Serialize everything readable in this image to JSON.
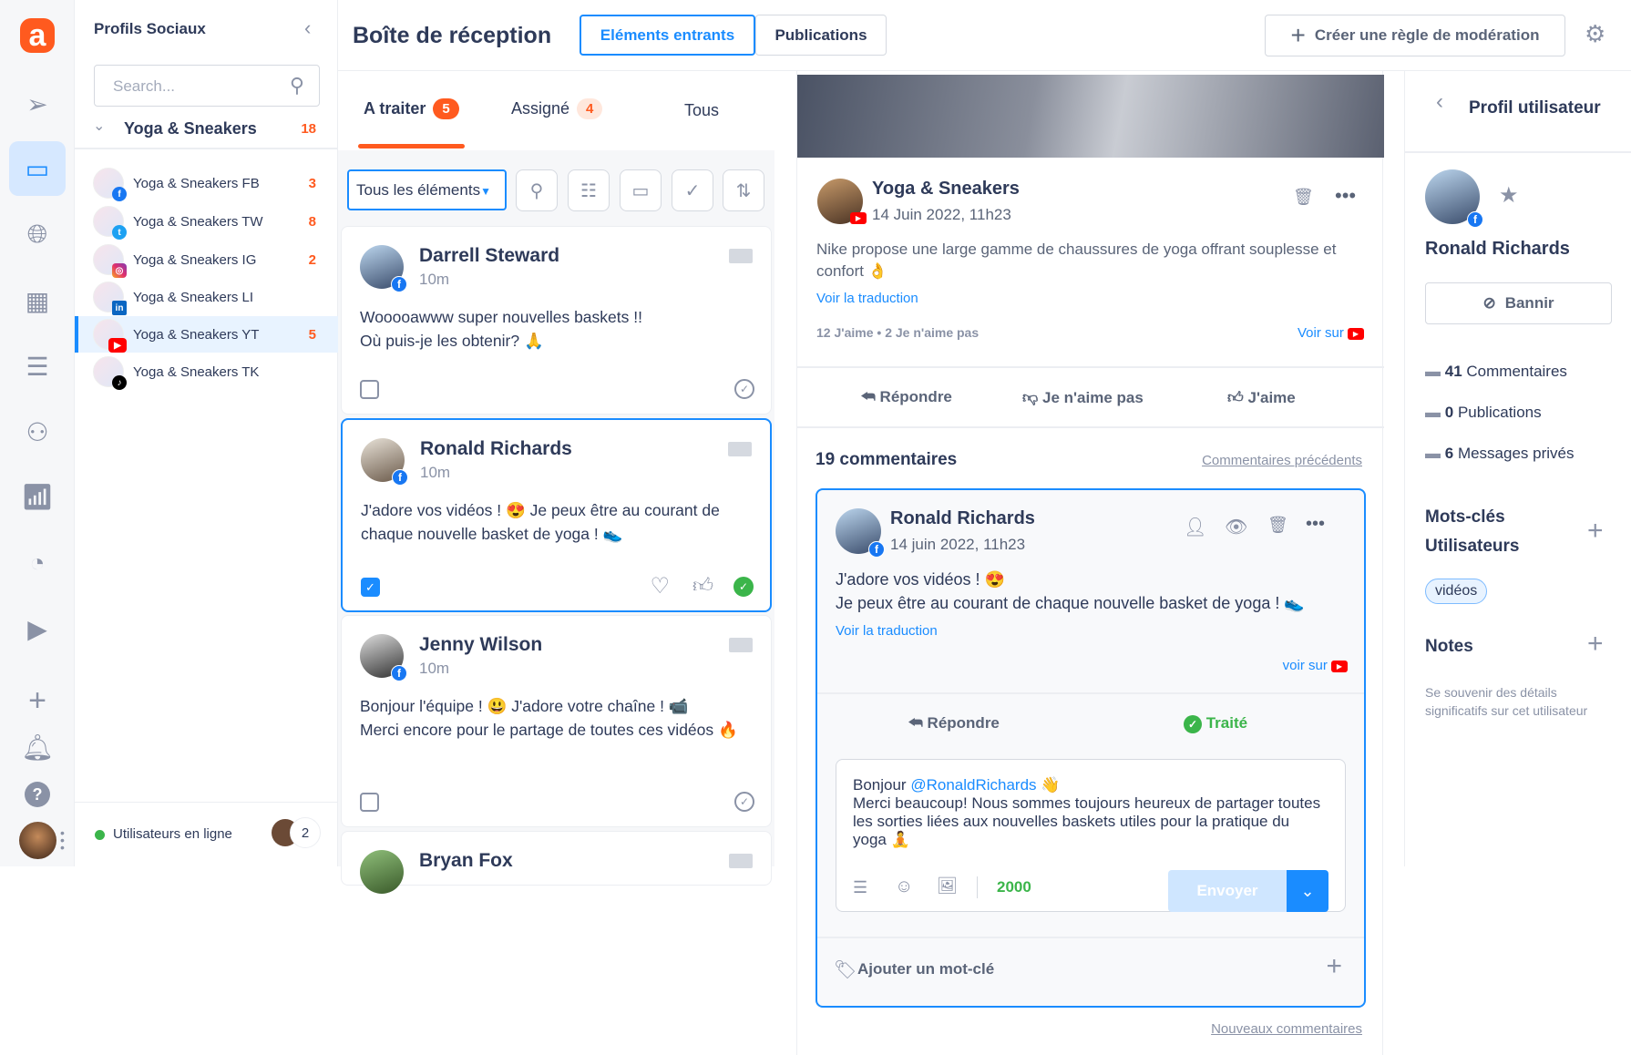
{
  "rail": {
    "items": [
      "send-icon",
      "inbox-icon",
      "globe-search-icon",
      "calendar-icon",
      "planner-icon",
      "users-icon",
      "analytics-icon",
      "dashboard-icon",
      "media-library-icon",
      "plus-icon",
      "bell-icon",
      "help-icon"
    ],
    "active": "inbox-icon"
  },
  "social": {
    "title": "Profils Sociaux",
    "search_placeholder": "Search...",
    "group": {
      "name": "Yoga & Sneakers",
      "count": "18"
    },
    "profiles": [
      {
        "name": "Yoga & Sneakers FB",
        "count": "3",
        "network": "facebook"
      },
      {
        "name": "Yoga & Sneakers TW",
        "count": "8",
        "network": "twitter"
      },
      {
        "name": "Yoga & Sneakers IG",
        "count": "2",
        "network": "instagram"
      },
      {
        "name": "Yoga & Sneakers LI",
        "count": "",
        "network": "linkedin"
      },
      {
        "name": "Yoga & Sneakers YT",
        "count": "5",
        "network": "youtube"
      },
      {
        "name": "Yoga & Sneakers TK",
        "count": "",
        "network": "tiktok"
      }
    ],
    "online_label": "Utilisateurs en ligne",
    "online_count": "2"
  },
  "header": {
    "title": "Boîte de réception",
    "tabs": [
      "Eléments entrants",
      "Publications"
    ],
    "create_rule": "Créer une règle de modération"
  },
  "inbox": {
    "tabs": [
      {
        "label": "A traiter",
        "count": "5"
      },
      {
        "label": "Assigné",
        "count": "4"
      },
      {
        "label": "Tous"
      }
    ],
    "filter": "Tous les éléments",
    "items": [
      {
        "name": "Darrell Steward",
        "time": "10m",
        "text": "Wooooawww super nouvelles baskets !!\nOù puis-je les obtenir? 🙏",
        "checked": false
      },
      {
        "name": "Ronald Richards",
        "time": "10m",
        "text": "J'adore vos vidéos ! 😍  Je peux être au courant de chaque nouvelle basket de yoga ! 👟",
        "checked": true
      },
      {
        "name": "Jenny Wilson",
        "time": "10m",
        "text": "Bonjour l'équipe ! 😃 J'adore votre chaîne ! 📹\nMerci encore pour le partage de toutes ces vidéos 🔥",
        "checked": false
      },
      {
        "name": "Bryan Fox"
      }
    ]
  },
  "post": {
    "author": "Yoga & Sneakers",
    "date": "14 Juin 2022, 11h23",
    "text": "Nike propose une large gamme de chaussures de yoga offrant souplesse et confort 👌",
    "translate": "Voir la traduction",
    "likes": "12 J'aime",
    "dislikes": "2 Je n'aime pas",
    "view_on": "Voir sur",
    "actions": [
      "Répondre",
      "Je n'aime pas",
      "J'aime"
    ],
    "comments_title": "19 commentaires",
    "prev_comments": "Commentaires précédents",
    "new_comments": "Nouveaux commentaires",
    "comment": {
      "author": "Ronald Richards",
      "date": "14 juin 2022, 11h23",
      "line1": "J'adore vos vidéos ! 😍",
      "line2": "Je peux être au courant de chaque nouvelle basket de yoga ! 👟",
      "translate": "Voir la traduction",
      "view_on": "voir sur",
      "reply": "Répondre",
      "done": "Traité",
      "reply_greeting": "Bonjour ",
      "reply_mention": "@RonaldRichards",
      "reply_wave": " 👋",
      "reply_body": "Merci beaucoup! Nous sommes toujours heureux de partager toutes les sorties liées aux nouvelles baskets utiles pour la pratique du yoga 🧘",
      "char_count": "2000",
      "send": "Envoyer",
      "add_keyword": "Ajouter un mot-clé"
    }
  },
  "profile": {
    "title": "Profil utilisateur",
    "name": "Ronald Richards",
    "ban": "Bannir",
    "stats": [
      {
        "value": "41",
        "label": "Commentaires"
      },
      {
        "value": "0",
        "label": "Publications"
      },
      {
        "value": "6",
        "label": "Messages privés"
      }
    ],
    "keywords_title": "Mots-clés Utilisateurs",
    "keywords": [
      "vidéos"
    ],
    "notes_title": "Notes",
    "notes_hint": "Se souvenir des détails significatifs sur cet utilisateur"
  },
  "colors": {
    "accent": "#1a8cff",
    "brand": "#ff5a1f",
    "success": "#3bb54a"
  }
}
